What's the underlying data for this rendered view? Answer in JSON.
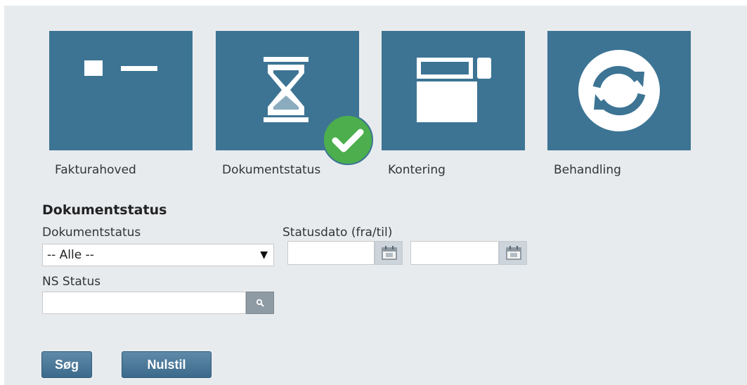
{
  "tiles": [
    {
      "label": "Fakturahoved",
      "icon": "invoice-header-icon"
    },
    {
      "label": "Dokumentstatus",
      "icon": "hourglass-icon"
    },
    {
      "label": "Kontering",
      "icon": "posting-icon"
    },
    {
      "label": "Behandling",
      "icon": "refresh-icon"
    }
  ],
  "section": {
    "title": "Dokumentstatus",
    "doc_status_label": "Dokumentstatus",
    "doc_status_value": "-- Alle --",
    "status_date_label": "Statusdato (fra/til)",
    "ns_status_label": "NS Status"
  },
  "buttons": {
    "search": "Søg",
    "reset": "Nulstil"
  },
  "colors": {
    "tile": "#3d7494",
    "check": "#4cae4c",
    "panel": "#e8ebee"
  }
}
